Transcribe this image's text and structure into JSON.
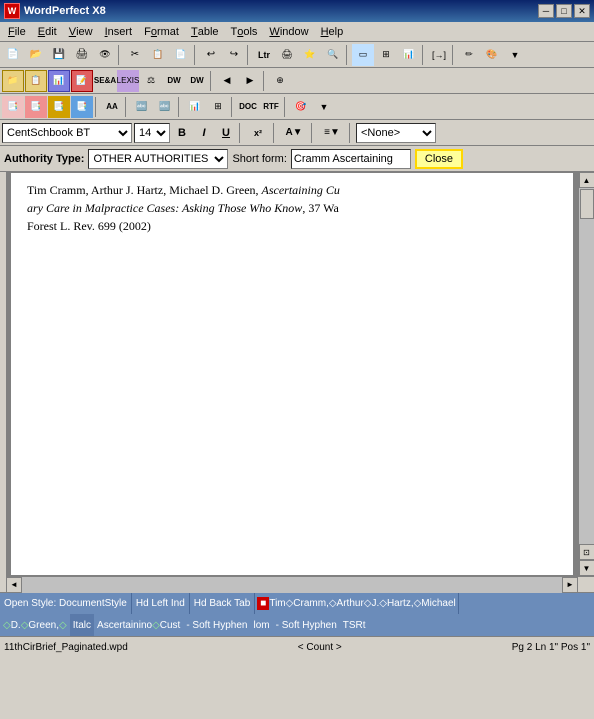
{
  "titlebar": {
    "icon": "WP",
    "title": "WordPerfect X8",
    "min_btn": "─",
    "max_btn": "□",
    "close_btn": "✕"
  },
  "menubar": {
    "items": [
      {
        "label": "File",
        "underline": "F"
      },
      {
        "label": "Edit",
        "underline": "E"
      },
      {
        "label": "View",
        "underline": "V"
      },
      {
        "label": "Insert",
        "underline": "I"
      },
      {
        "label": "Format",
        "underline": "o"
      },
      {
        "label": "Table",
        "underline": "T"
      },
      {
        "label": "Tools",
        "underline": "T"
      },
      {
        "label": "Window",
        "underline": "W"
      },
      {
        "label": "Help",
        "underline": "H"
      }
    ]
  },
  "toolbar1": {
    "buttons": [
      "📄",
      "📂",
      "💾",
      "🖨",
      "👁",
      "✂",
      "📋",
      "📄",
      "↩",
      "↪",
      "Ltr",
      "🖨",
      "⭐",
      "🔍",
      "",
      "",
      "",
      "",
      "",
      "",
      "📊",
      "",
      "[]",
      "",
      "",
      "✏",
      "🎨"
    ]
  },
  "toolbar2": {
    "buttons": [
      "",
      "",
      "",
      "",
      "",
      "SE&A",
      "LEXIS",
      "",
      "DW",
      "DW",
      "",
      "",
      "",
      "",
      "",
      ""
    ]
  },
  "toolbar3": {
    "buttons": [
      "",
      "",
      "",
      "",
      "",
      "AA",
      "",
      "",
      "",
      "",
      "",
      "DOC",
      "RTF",
      ""
    ]
  },
  "formatting": {
    "font_name": "CentSchbook BT",
    "font_size": "14",
    "bold": "B",
    "italic": "I",
    "underline": "U",
    "superscript": "x²",
    "highlight": "A",
    "align": "≡",
    "style": "<None>"
  },
  "authority": {
    "type_label": "Authority Type:",
    "type_value": "OTHER AUTHORITIES",
    "short_label": "Short form:",
    "short_value": "Cramm Ascertaining",
    "close_label": "Close"
  },
  "document": {
    "lines": [
      "Tim Cramm, Arthur J. Hartz, Michael D. Green, Ascertaining Cu",
      "ary Care in Malpractice Cases: Asking Those Who Know, 37 Wa",
      "Forest L. Rev. 699 (2002)"
    ]
  },
  "statusbar1": {
    "items": [
      "Open Style: DocumentStyle",
      "Hd Left Ind",
      "Hd Back Tab",
      "Tim◇Cramm,◇Arthur◇J.◇Hartz,◇Michael"
    ],
    "marker_color": "#cc0000"
  },
  "statusbar2": {
    "items": [
      "◇D.◇Green,◇",
      "Italc",
      "Ascertainino◇Cust",
      "- Soft Hyphen",
      "lom",
      "- Soft Hyphen",
      "TSRt"
    ]
  },
  "bottombar": {
    "filename": "11thCirBrief_Paginated.wpd",
    "count": "< Count >",
    "position": "Pg 2 Ln 1\" Pos 1\""
  }
}
